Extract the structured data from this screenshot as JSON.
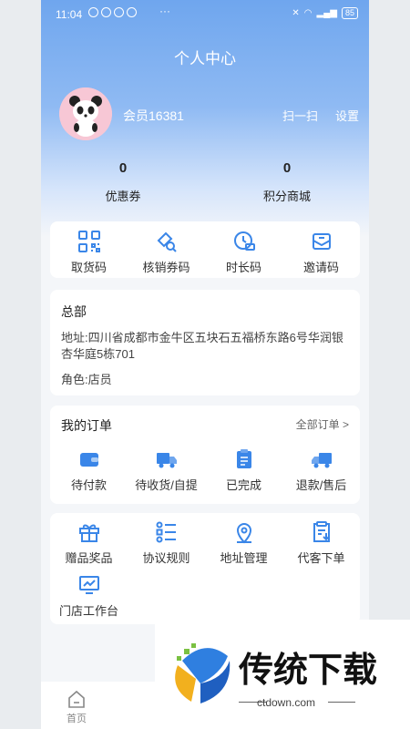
{
  "status": {
    "time": "11:04",
    "battery": "85",
    "dots": "···"
  },
  "header": {
    "title": "个人中心"
  },
  "profile": {
    "member_name": "会员16381",
    "scan_label": "扫一扫",
    "settings_label": "设置"
  },
  "stats": [
    {
      "value": "0",
      "label": "优惠券"
    },
    {
      "value": "0",
      "label": "积分商城"
    }
  ],
  "quick_actions": [
    {
      "label": "取货码",
      "icon": "qr-code-icon"
    },
    {
      "label": "核销券码",
      "icon": "ticket-search-icon"
    },
    {
      "label": "时长码",
      "icon": "clock-ticket-icon"
    },
    {
      "label": "邀请码",
      "icon": "invite-envelope-icon"
    }
  ],
  "store": {
    "title": "总部",
    "address": "地址:四川省成都市金牛区五块石五福桥东路6号华润银杏华庭5栋701",
    "role": "角色:店员"
  },
  "orders": {
    "title": "我的订单",
    "all_label": "全部订单 >",
    "items": [
      {
        "label": "待付款",
        "icon": "wallet-icon"
      },
      {
        "label": "待收货/自提",
        "icon": "truck-icon"
      },
      {
        "label": "已完成",
        "icon": "clipboard-icon"
      },
      {
        "label": "退款/售后",
        "icon": "return-truck-icon"
      }
    ]
  },
  "tools": [
    {
      "label": "赠品奖品",
      "icon": "gift-icon"
    },
    {
      "label": "协议规则",
      "icon": "list-icon"
    },
    {
      "label": "地址管理",
      "icon": "location-pin-icon"
    },
    {
      "label": "代客下单",
      "icon": "order-download-icon"
    },
    {
      "label": "门店工作台",
      "icon": "monitor-chart-icon"
    }
  ],
  "tabbar": {
    "home_label": "首页"
  },
  "watermark": {
    "brand": "传统下载",
    "url": "ctdown.com"
  },
  "colors": {
    "accent": "#3a86e8",
    "header_gradient_top": "#6fa6ee"
  }
}
